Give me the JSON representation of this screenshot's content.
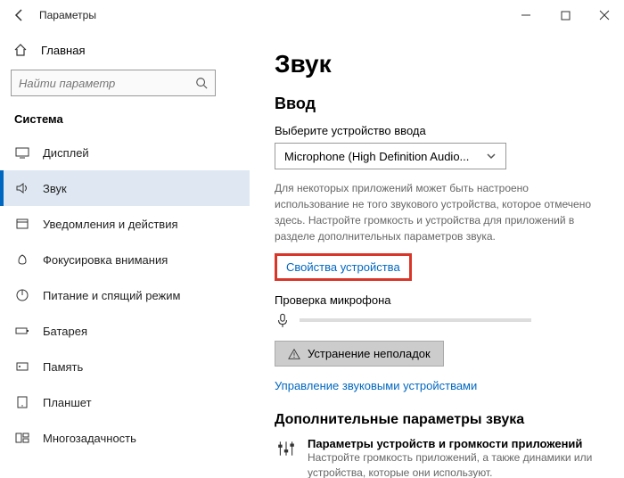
{
  "titlebar": {
    "title": "Параметры"
  },
  "sidebar": {
    "home": "Главная",
    "search_placeholder": "Найти параметр",
    "category": "Система",
    "items": [
      {
        "label": "Дисплей"
      },
      {
        "label": "Звук"
      },
      {
        "label": "Уведомления и действия"
      },
      {
        "label": "Фокусировка внимания"
      },
      {
        "label": "Питание и спящий режим"
      },
      {
        "label": "Батарея"
      },
      {
        "label": "Память"
      },
      {
        "label": "Планшет"
      },
      {
        "label": "Многозадачность"
      }
    ]
  },
  "main": {
    "page_title": "Звук",
    "section_input": "Ввод",
    "pick_device_label": "Выберите устройство ввода",
    "device_selected": "Microphone (High Definition Audio...",
    "note": "Для некоторых приложений может быть настроено использование не того звукового устройства, которое отмечено здесь. Настройте громкость и устройства для приложений в разделе дополнительных параметров звука.",
    "device_properties": "Свойства устройства",
    "mic_test_label": "Проверка микрофона",
    "troubleshoot": "Устранение неполадок",
    "manage_devices": "Управление звуковыми устройствами",
    "advanced_title": "Дополнительные параметры звука",
    "adv_item_title": "Параметры устройств и громкости приложений",
    "adv_item_sub": "Настройте громкость приложений, а также динамики или устройства, которые они используют."
  }
}
